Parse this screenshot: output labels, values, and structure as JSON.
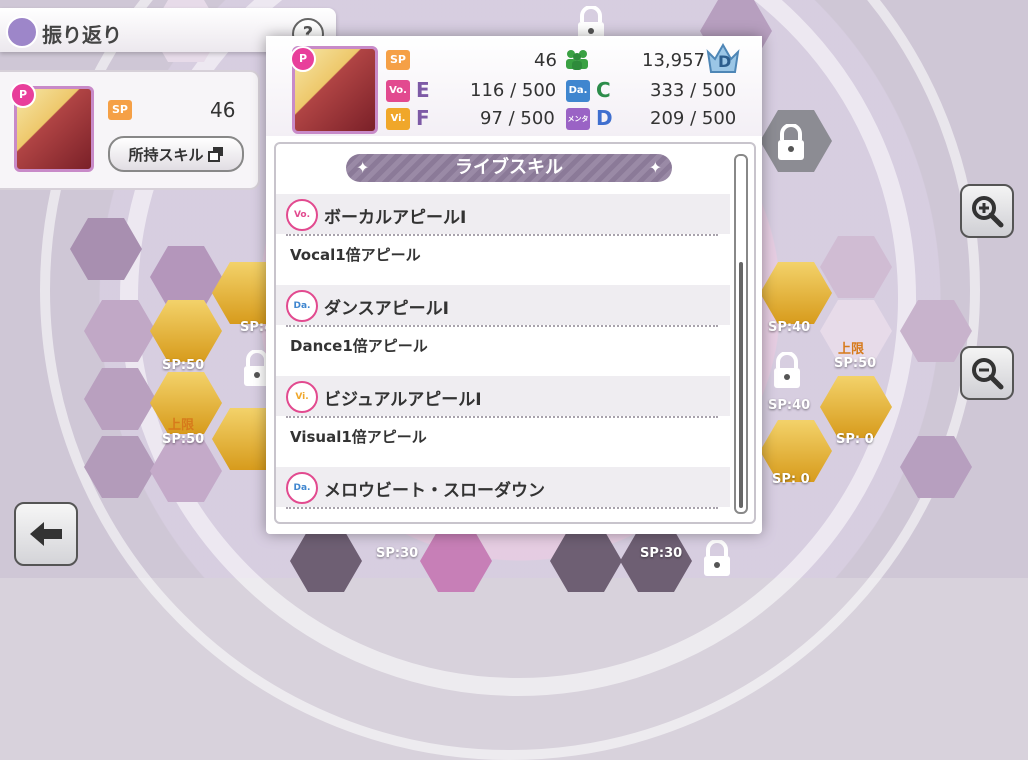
{
  "header": {
    "title": "振り返り",
    "help_label": "?"
  },
  "left_card": {
    "sp_label": "SP",
    "sp_value": "46",
    "skill_button_label": "所持スキル",
    "badge": "P"
  },
  "stats": {
    "badge": "P",
    "sp_label": "SP",
    "sp_value": "46",
    "fans_value": "13,957",
    "rank_grade": "D",
    "vocal": {
      "label": "Vo.",
      "grade": "E",
      "value": "116 / 500"
    },
    "dance": {
      "label": "Da.",
      "grade": "C",
      "value": "333 / 500"
    },
    "visual": {
      "label": "Vi.",
      "grade": "F",
      "value": "97 / 500"
    },
    "mental": {
      "label": "メンタル",
      "grade": "D",
      "value": "209 / 500"
    }
  },
  "skills": {
    "header": "ライブスキル",
    "items": [
      {
        "icon": "Vo.",
        "name": "ボーカルアピールⅠ",
        "desc": "Vocal1倍アピール"
      },
      {
        "icon": "Da.",
        "name": "ダンスアピールⅠ",
        "desc": "Dance1倍アピール"
      },
      {
        "icon": "Vi.",
        "name": "ビジュアルアピールⅠ",
        "desc": "Visual1倍アピール"
      },
      {
        "icon": "Da.",
        "name": "メロウビート・スローダウン",
        "desc": ""
      }
    ]
  },
  "board": {
    "labels": [
      "SP:50",
      "SP:50",
      "SP:40",
      "SP:50",
      "SP:40",
      "SP: 0",
      "SP: 0",
      "SP:30",
      "SP:30",
      "SP:4",
      "SP:4"
    ],
    "up_labels": [
      "上限",
      "上限"
    ]
  }
}
